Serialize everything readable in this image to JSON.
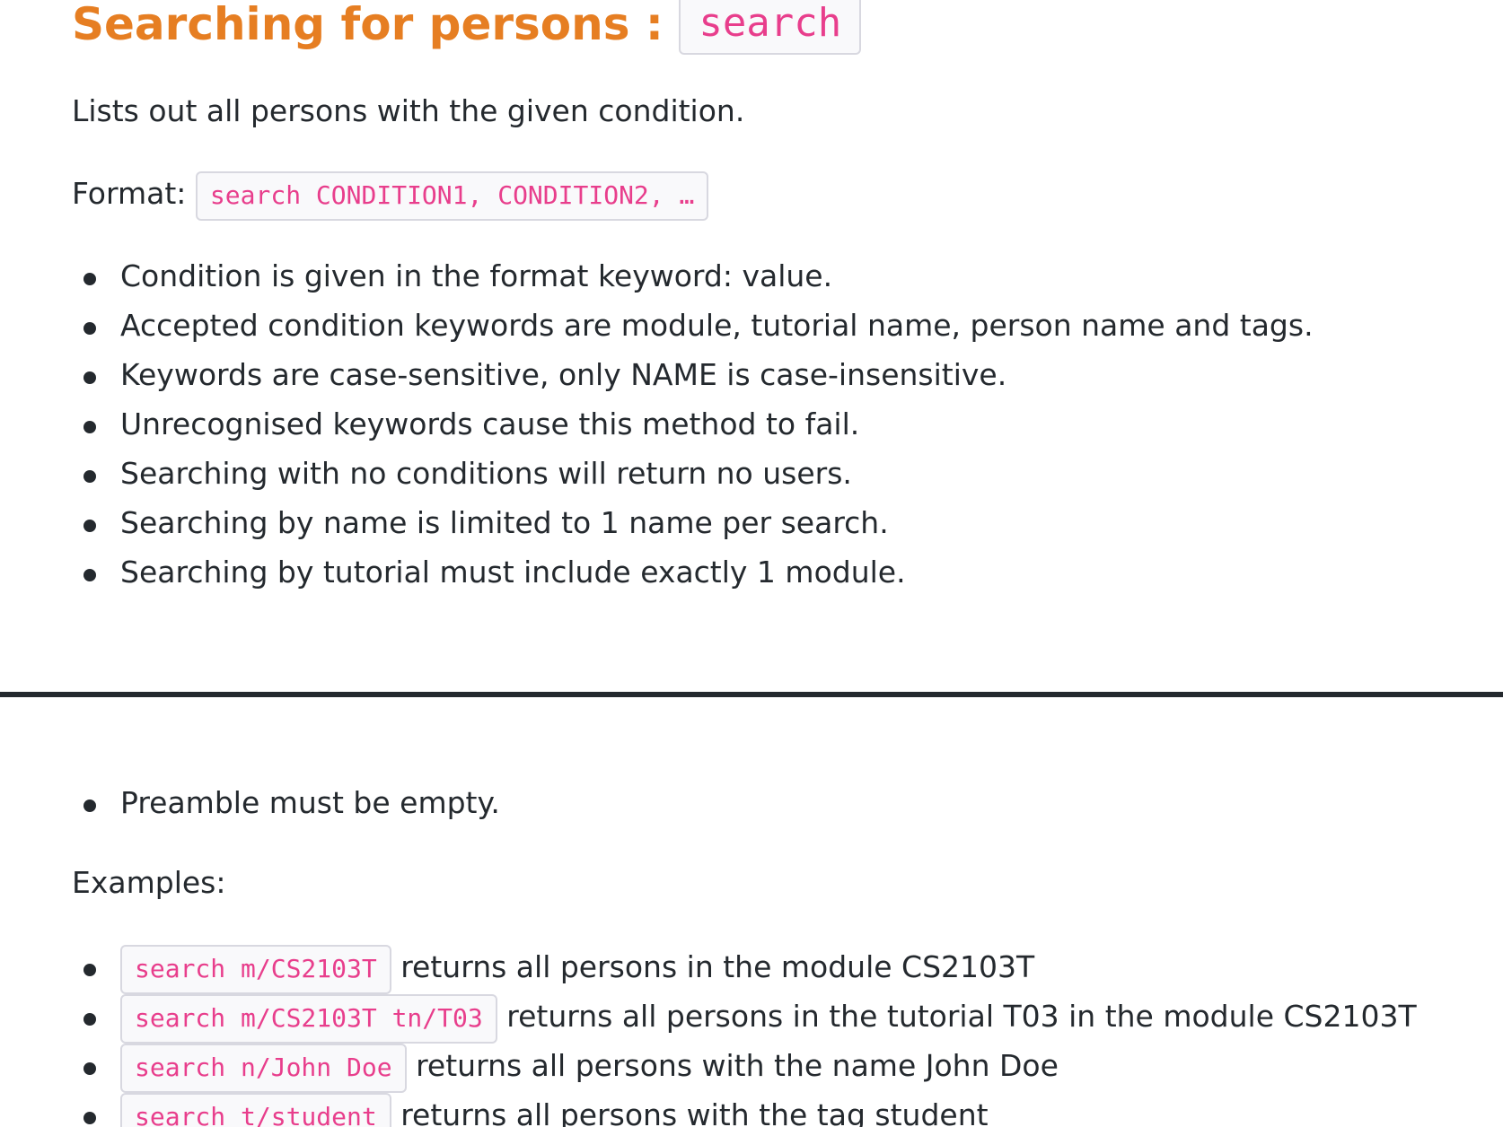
{
  "section": {
    "title": "Searching for persons",
    "separator": ":",
    "command": "search"
  },
  "description": "Lists out all persons with the given condition.",
  "format": {
    "label": "Format:",
    "code": "search CONDITION1, CONDITION2, …"
  },
  "rules": [
    "Condition is given in the format keyword: value.",
    "Accepted condition keywords are module, tutorial name, person name and tags.",
    "Keywords are case-sensitive, only NAME is case-insensitive.",
    "Unrecognised keywords cause this method to fail.",
    "Searching with no conditions will return no users.",
    "Searching by name is limited to 1 name per search.",
    "Searching by tutorial must include exactly 1 module."
  ],
  "extra_rules": [
    "Preamble must be empty."
  ],
  "examples_label": "Examples:",
  "examples": [
    {
      "code": "search m/CS2103T",
      "text": "returns all persons in the module CS2103T"
    },
    {
      "code": "search m/CS2103T tn/T03",
      "text": "returns all persons in the tutorial T03 in the module CS2103T"
    },
    {
      "code": "search n/John Doe",
      "text": "returns all persons with the name John Doe"
    },
    {
      "code": "search t/student",
      "text": "returns all persons with the tag student"
    }
  ]
}
